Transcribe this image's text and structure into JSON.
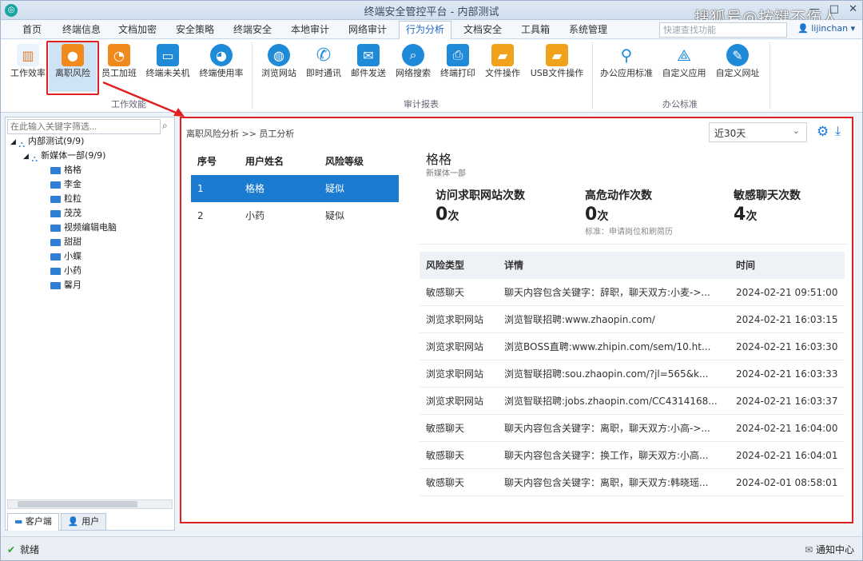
{
  "window": {
    "logo": "◎",
    "title": "终端安全管控平台 - 内部测试",
    "watermark": "搜狐号@按键不伤人",
    "controls": [
      "—",
      "□",
      "✕"
    ]
  },
  "menu": {
    "items": [
      "首页",
      "终端信息",
      "文档加密",
      "安全策略",
      "终端安全",
      "本地审计",
      "网络审计",
      "行为分析",
      "文档安全",
      "工具箱",
      "系统管理"
    ],
    "active_index": 7,
    "search_placeholder": "快速查找功能",
    "user": "lijinchan ▾"
  },
  "ribbon": {
    "buttons": [
      {
        "label": "工作效率",
        "icon": "bar-chart-icon",
        "color": "#e07a2a"
      },
      {
        "label": "离职风险",
        "icon": "user-exit-icon",
        "color": "#f08a1c"
      },
      {
        "label": "员工加班",
        "icon": "user-clock-icon",
        "color": "#f08a1c"
      },
      {
        "label": "终端未关机",
        "icon": "monitor-power-icon",
        "color": "#1f8ad8"
      },
      {
        "label": "终端使用率",
        "icon": "pie-chart-icon",
        "color": "#1f8ad8"
      },
      {
        "label": "浏览网站",
        "icon": "globe-icon",
        "color": "#1f8ad8"
      },
      {
        "label": "即时通讯",
        "icon": "phone-icon",
        "color": "#1f8ad8"
      },
      {
        "label": "邮件发送",
        "icon": "mail-icon",
        "color": "#1f8ad8"
      },
      {
        "label": "网络搜索",
        "icon": "search-globe-icon",
        "color": "#1f8ad8"
      },
      {
        "label": "终端打印",
        "icon": "printer-icon",
        "color": "#1f8ad8"
      },
      {
        "label": "文件操作",
        "icon": "folder-icon",
        "color": "#f0a21c"
      },
      {
        "label": "USB文件操作",
        "icon": "usb-folder-icon",
        "color": "#f0a21c"
      },
      {
        "label": "办公应用标准",
        "icon": "user-search-icon",
        "color": "#1f8ad8"
      },
      {
        "label": "自定义应用",
        "icon": "compass-icon",
        "color": "#1f8ad8"
      },
      {
        "label": "自定义网址",
        "icon": "globe-edit-icon",
        "color": "#1f8ad8"
      }
    ],
    "groups": [
      "工作效能",
      "审计报表",
      "办公标准"
    ],
    "highlighted_index": 1
  },
  "sidebar": {
    "filter_placeholder": "在此输入关键字筛选...",
    "tree": [
      {
        "label": "内部测试(9/9)",
        "level": 0,
        "type": "org"
      },
      {
        "label": "新媒体一部(9/9)",
        "level": 1,
        "type": "org"
      },
      {
        "label": "格格",
        "level": 2,
        "type": "pc"
      },
      {
        "label": "李金",
        "level": 2,
        "type": "pc"
      },
      {
        "label": "粒粒",
        "level": 2,
        "type": "pc"
      },
      {
        "label": "茂茂",
        "level": 2,
        "type": "pc"
      },
      {
        "label": "视频编辑电脑",
        "level": 2,
        "type": "pc"
      },
      {
        "label": "甜甜",
        "level": 2,
        "type": "pc"
      },
      {
        "label": "小蝶",
        "level": 2,
        "type": "pc"
      },
      {
        "label": "小药",
        "level": 2,
        "type": "pc"
      },
      {
        "label": "馨月",
        "level": 2,
        "type": "pc"
      }
    ],
    "tabs": [
      "客户端",
      "用户"
    ]
  },
  "content": {
    "breadcrumb": "离职风险分析 >> 员工分析",
    "period": "近30天",
    "user_table": {
      "headers": [
        "序号",
        "用户姓名",
        "风险等级"
      ],
      "rows": [
        {
          "no": "1",
          "name": "格格",
          "level": "疑似"
        },
        {
          "no": "2",
          "name": "小药",
          "level": "疑似"
        }
      ],
      "selected_index": 0
    },
    "detail": {
      "name": "格格",
      "dept": "新媒体一部",
      "stats": [
        {
          "label": "访问求职网站次数",
          "value": "0",
          "unit": "次",
          "note": ""
        },
        {
          "label": "高危动作次数",
          "value": "0",
          "unit": "次",
          "note": "标准：申请岗位和刷简历"
        },
        {
          "label": "敏感聊天次数",
          "value": "4",
          "unit": "次",
          "note": ""
        }
      ]
    },
    "risk_table": {
      "headers": [
        "风险类型",
        "详情",
        "时间"
      ],
      "rows": [
        {
          "type": "敏感聊天",
          "detail": "聊天内容包含关键字：辞职，聊天双方:小麦->...",
          "time": "2024-02-21 09:51:00"
        },
        {
          "type": "浏览求职网站",
          "detail": "浏览智联招聘:www.zhaopin.com/",
          "time": "2024-02-21 16:03:15"
        },
        {
          "type": "浏览求职网站",
          "detail": "浏览BOSS直聘:www.zhipin.com/sem/10.ht...",
          "time": "2024-02-21 16:03:30"
        },
        {
          "type": "浏览求职网站",
          "detail": "浏览智联招聘:sou.zhaopin.com/?jl=565&k...",
          "time": "2024-02-21 16:03:33"
        },
        {
          "type": "浏览求职网站",
          "detail": "浏览智联招聘:jobs.zhaopin.com/CC4314168...",
          "time": "2024-02-21 16:03:37"
        },
        {
          "type": "敏感聊天",
          "detail": "聊天内容包含关键字：离职，聊天双方:小高->...",
          "time": "2024-02-21 16:04:00"
        },
        {
          "type": "敏感聊天",
          "detail": "聊天内容包含关键字：换工作，聊天双方:小高...",
          "time": "2024-02-21 16:04:01"
        },
        {
          "type": "敏感聊天",
          "detail": "聊天内容包含关键字：离职，聊天双方:韩晓瑶...",
          "time": "2024-02-01 08:58:01"
        }
      ]
    }
  },
  "status": {
    "text": "就绪",
    "notify": "通知中心"
  }
}
